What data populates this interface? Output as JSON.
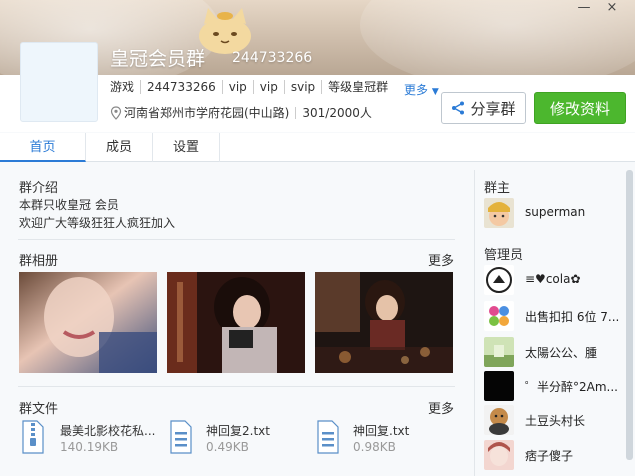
{
  "header": {
    "group_name": "皇冠会员群",
    "group_id": "244733266",
    "window_controls": {
      "minimize": "—",
      "close": "×"
    }
  },
  "info": {
    "tags": [
      "游戏",
      "244733266",
      "vip",
      "vip",
      "svip",
      "等级皇冠群"
    ],
    "more_label": "更多",
    "location": "河南省郑州市学府花园(中山路)",
    "member_count": "301/2000人"
  },
  "actions": {
    "share_label": "分享群",
    "edit_label": "修改资料"
  },
  "tabs": [
    {
      "label": "首页",
      "active": true
    },
    {
      "label": "成员",
      "active": false
    },
    {
      "label": "设置",
      "active": false
    }
  ],
  "intro": {
    "title": "群介绍",
    "lines": [
      "本群只收皇冠 会员",
      "欢迎广大等级狂狂人疯狂加入"
    ]
  },
  "album": {
    "title": "群相册",
    "more_label": "更多"
  },
  "files_section": {
    "title": "群文件",
    "more_label": "更多",
    "files": [
      {
        "name": "最美北影校花私...",
        "size": "140.19KB",
        "icon": "zip-file-icon"
      },
      {
        "name": "神回复2.txt",
        "size": "0.49KB",
        "icon": "text-file-icon"
      },
      {
        "name": "神回复.txt",
        "size": "0.98KB",
        "icon": "text-file-icon"
      }
    ]
  },
  "owner_section": {
    "title": "群主",
    "owner": {
      "name": "superman"
    }
  },
  "admin_section": {
    "title": "管理员",
    "admins": [
      {
        "name": "≡♥cola✿"
      },
      {
        "name": "出售扣扣 6位 7..."
      },
      {
        "name": "太陽公公、腫"
      },
      {
        "name": "゜半分醉°2Am..."
      },
      {
        "name": "土豆头村长"
      },
      {
        "name": "痞子傻子"
      }
    ]
  },
  "colors": {
    "accent": "#2b7bd6",
    "primary_button": "#4cb72e"
  }
}
